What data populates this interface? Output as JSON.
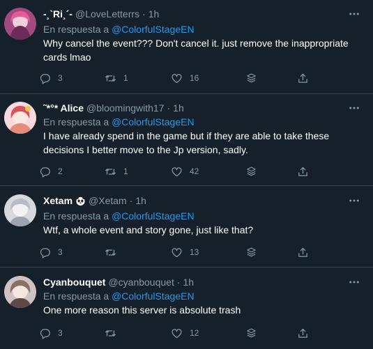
{
  "reply_prefix": "En respuesta a",
  "tweets": [
    {
      "name": "-¸`Ri¸´-",
      "handle": "@LoveLetterrs",
      "time": "1h",
      "mention": "@ColorfulStageEN",
      "text": "Why cancel the event??? Don't cancel it. just remove the inappropriate cards lmao",
      "replies": "3",
      "retweets": "1",
      "likes": "16"
    },
    {
      "name": "˜*°* Alice",
      "handle": "@bloomingwith17",
      "time": "1h",
      "mention": "@ColorfulStageEN",
      "text": "I have already spend in the game  but if they are able to take these decisions I better move to the Jp version, sadly.",
      "replies": "2",
      "retweets": "1",
      "likes": "42"
    },
    {
      "name": "Xetam",
      "handle": "@Xetam",
      "time": "1h",
      "mention": "@ColorfulStageEN",
      "text": "Wtf, a whole event and story gone, just like that?",
      "replies": "3",
      "retweets": "",
      "likes": "13"
    },
    {
      "name": "Cyanbouquet",
      "handle": "@cyanbouquet",
      "time": "1h",
      "mention": "@ColorfulStageEN",
      "text": "One more reason this server is absolute trash",
      "replies": "3",
      "retweets": "",
      "likes": "12"
    }
  ],
  "colors": {
    "background": "#15202b",
    "divider": "#38444d",
    "text": "#ffffff",
    "secondary": "#8899a6",
    "link": "#1d9bf0"
  },
  "icons": [
    "reply-icon",
    "retweet-icon",
    "like-icon",
    "stack-icon",
    "share-icon",
    "more-icon",
    "panda-emoji-icon"
  ]
}
